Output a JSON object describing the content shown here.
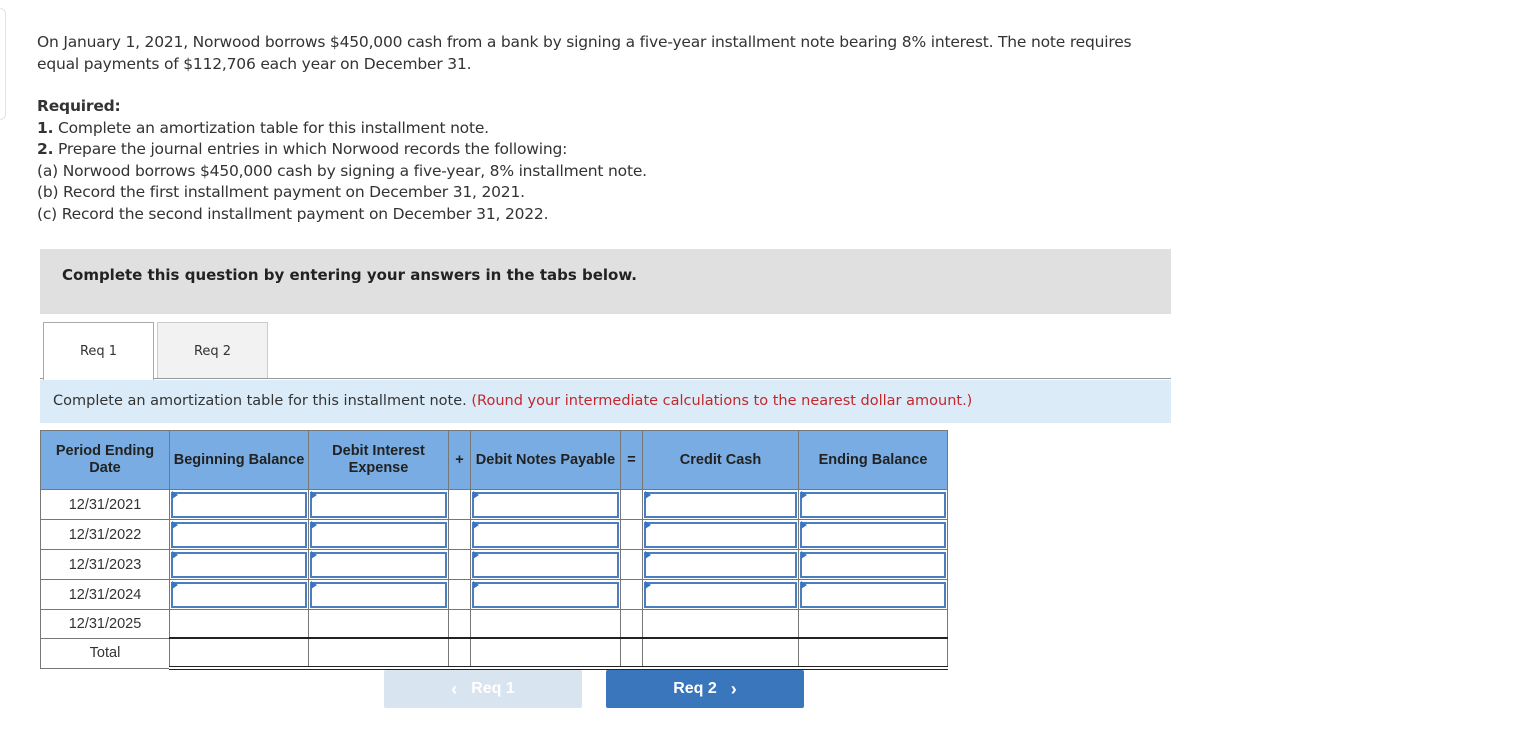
{
  "problem": {
    "intro": "On January 1, 2021, Norwood borrows $450,000 cash from a bank by signing a five-year installment note bearing 8% interest. The note requires equal payments of $112,706 each year on December 31.",
    "required_label": "Required:",
    "items": [
      {
        "num": "1.",
        "text": " Complete an amortization table for this installment note."
      },
      {
        "num": "2.",
        "text": " Prepare the journal entries in which Norwood records the following:"
      }
    ],
    "sub_items": [
      "(a) Norwood borrows $450,000 cash by signing a five-year, 8% installment note.",
      "(b) Record the first installment payment on December 31, 2021.",
      "(c) Record the second installment payment on December 31, 2022."
    ]
  },
  "instruction_banner": "Complete this question by entering your answers in the tabs below.",
  "tabs": [
    {
      "label": "Req 1",
      "active": true
    },
    {
      "label": "Req 2",
      "active": false
    }
  ],
  "hint": {
    "text": "Complete an amortization table for this installment note.",
    "note": "(Round your intermediate calculations to the nearest dollar amount.)"
  },
  "table": {
    "headers": {
      "date": "Period Ending Date",
      "beginning": "Beginning Balance",
      "interest": "Debit Interest Expense",
      "plus": "+",
      "notes_payable": "Debit Notes Payable",
      "equals": "=",
      "cash": "Credit Cash",
      "ending": "Ending Balance"
    },
    "rows": [
      {
        "date": "12/31/2021",
        "beginning": "",
        "interest": "",
        "notes_payable": "",
        "cash": "",
        "ending": ""
      },
      {
        "date": "12/31/2022",
        "beginning": "",
        "interest": "",
        "notes_payable": "",
        "cash": "",
        "ending": ""
      },
      {
        "date": "12/31/2023",
        "beginning": "",
        "interest": "",
        "notes_payable": "",
        "cash": "",
        "ending": ""
      },
      {
        "date": "12/31/2024",
        "beginning": "",
        "interest": "",
        "notes_payable": "",
        "cash": "",
        "ending": ""
      },
      {
        "date": "12/31/2025",
        "beginning": "",
        "interest": "",
        "notes_payable": "",
        "cash": "",
        "ending": ""
      }
    ],
    "total_label": "Total"
  },
  "nav": {
    "prev_label": "Req 1",
    "next_label": "Req 2",
    "prev_icon": "chevron-left-icon",
    "next_icon": "chevron-right-icon"
  }
}
